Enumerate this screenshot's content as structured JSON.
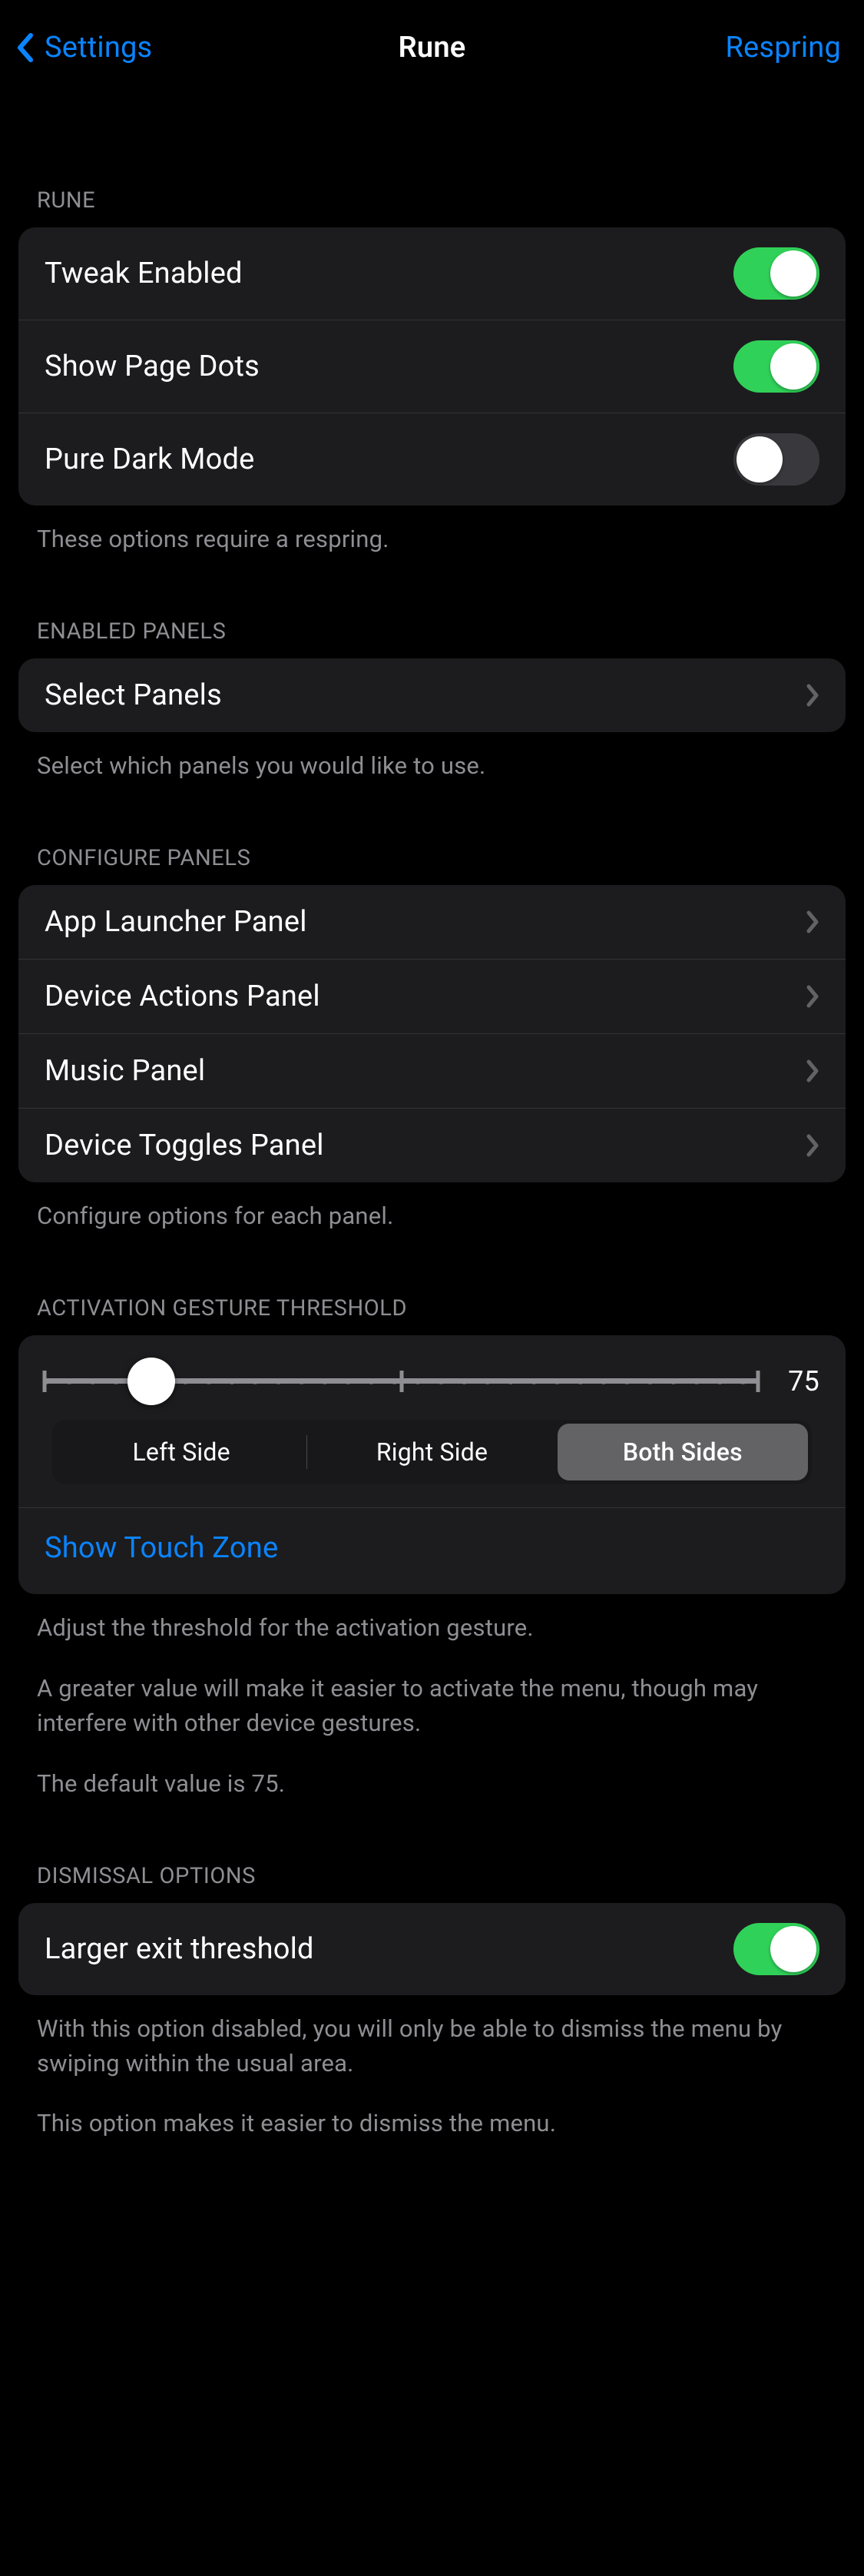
{
  "nav": {
    "back_label": "Settings",
    "title": "Rune",
    "action_label": "Respring"
  },
  "sections": {
    "rune": {
      "header": "RUNE",
      "rows": {
        "tweak_enabled": {
          "label": "Tweak Enabled",
          "value": true
        },
        "show_page_dots": {
          "label": "Show Page Dots",
          "value": true
        },
        "pure_dark_mode": {
          "label": "Pure Dark Mode",
          "value": false
        }
      },
      "footer": "These options require a respring."
    },
    "enabled_panels": {
      "header": "ENABLED PANELS",
      "rows": {
        "select_panels": {
          "label": "Select Panels"
        }
      },
      "footer": "Select which panels you would like to use."
    },
    "configure_panels": {
      "header": "CONFIGURE PANELS",
      "rows": {
        "app_launcher": {
          "label": "App Launcher Panel"
        },
        "device_actions": {
          "label": "Device Actions Panel"
        },
        "music": {
          "label": "Music Panel"
        },
        "device_toggles": {
          "label": "Device Toggles Panel"
        }
      },
      "footer": "Configure options for each panel."
    },
    "activation_gesture": {
      "header": "ACTIVATION GESTURE THRESHOLD",
      "slider": {
        "value": 75,
        "min": 0,
        "max": 500,
        "thumb_percent": 15
      },
      "segments": {
        "left": "Left Side",
        "right": "Right Side",
        "both": "Both Sides",
        "selected": "both"
      },
      "show_touch_zone": "Show Touch Zone",
      "footer_p1": "Adjust the threshold for the activation gesture.",
      "footer_p2": "A greater value will make it easier to activate the menu, though may interfere with other device gestures.",
      "footer_p3": "The default value is 75."
    },
    "dismissal": {
      "header": "DISMISSAL OPTIONS",
      "rows": {
        "larger_exit": {
          "label": "Larger exit threshold",
          "value": true
        }
      },
      "footer_p1": "With this option disabled, you will only be able to dismiss the menu by swiping within the usual area.",
      "footer_p2": "This option makes it easier to dismiss the menu."
    }
  }
}
